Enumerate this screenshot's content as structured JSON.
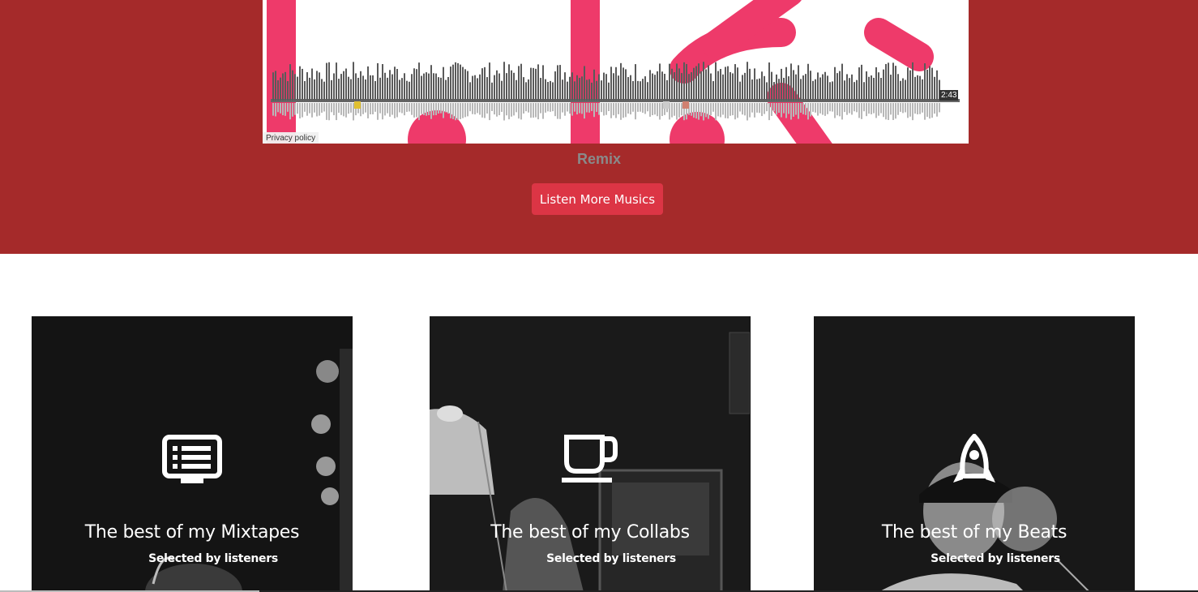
{
  "player": {
    "duration": "2:43",
    "privacy_label": "Privacy policy",
    "track_title": "Remix"
  },
  "hero": {
    "cta_label": "Listen More Musics"
  },
  "cards": [
    {
      "icon": "tv-list-icon",
      "title": "The best of my Mixtapes",
      "subtitle": "Selected by listeners"
    },
    {
      "icon": "coffee-cup-icon",
      "title": "The best of my Collabs",
      "subtitle": "Selected by listeners"
    },
    {
      "icon": "rocket-icon",
      "title": "The best of my Beats",
      "subtitle": "Selected by listeners"
    }
  ],
  "colors": {
    "hero_bg": "#a52a2a",
    "cta_bg": "#dc3545",
    "artwork_pink": "#ee3a6a"
  }
}
